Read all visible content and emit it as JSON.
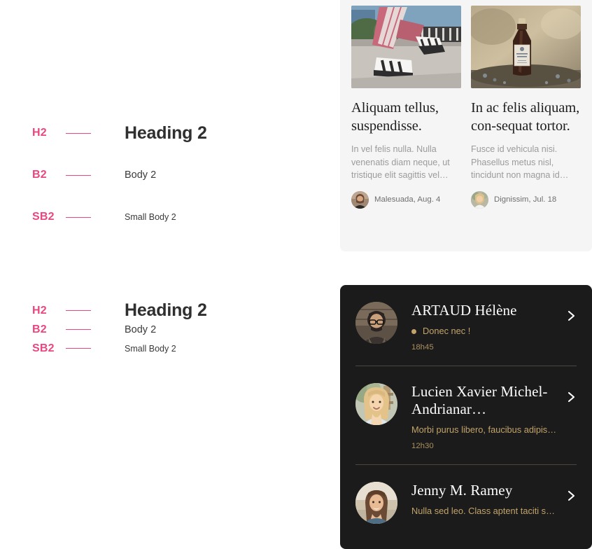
{
  "typography": {
    "groups": [
      {
        "name": "type-scale-loose",
        "rows": [
          {
            "tag": "H2",
            "sample": "Heading 2",
            "style": "s-h2"
          },
          {
            "tag": "B2",
            "sample": "Body 2",
            "style": "s-b2"
          },
          {
            "tag": "SB2",
            "sample": "Small Body 2",
            "style": "s-sb2"
          }
        ]
      },
      {
        "name": "type-scale-tight",
        "rows": [
          {
            "tag": "H2",
            "sample": "Heading 2",
            "style": "s-h2"
          },
          {
            "tag": "B2",
            "sample": "Body 2",
            "style": "s-b2"
          },
          {
            "tag": "SB2",
            "sample": "Small Body 2",
            "style": "s-sb2"
          }
        ]
      }
    ],
    "accent_color": "#ea4680",
    "sample_color": "#333333"
  },
  "articles_card": {
    "background": "#f5f5f5",
    "articles": [
      {
        "image_alt": "sneakers-photo",
        "title": "Aliquam tellus, suspendisse.",
        "excerpt": "In vel felis nulla. Nulla venenatis diam neque, ut tristique elit sagittis vel…",
        "author": "Malesuada,",
        "date": "Aug. 4",
        "byline": "Malesuada,  Aug. 4",
        "avatar_alt": "author-avatar-male"
      },
      {
        "image_alt": "bottle-photo",
        "title": "In ac felis aliquam, con-sequat tortor.",
        "excerpt": "Fusce id vehicula nisi. Phasellus metus nisl, tincidunt non magna id…",
        "author": "Dignissim,",
        "date": "Jul. 18",
        "byline": "Dignissim,  Jul. 18",
        "avatar_alt": "author-avatar-female"
      }
    ]
  },
  "messages_panel": {
    "background": "#1b1b1b",
    "accent_color": "#c2a46b",
    "items": [
      {
        "name": "ARTAUD Hélène",
        "preview": "Donec nec !",
        "time": "18h45",
        "unread": true,
        "avatar_alt": "contact-avatar-bearded-man"
      },
      {
        "name": "Lucien Xavier Michel-Andrianar…",
        "preview": "Morbi purus libero, faucibus adipiscing…",
        "time": "12h30",
        "unread": false,
        "avatar_alt": "contact-avatar-blonde-woman"
      },
      {
        "name": "Jenny M. Ramey",
        "preview": "Nulla sed leo. Class aptent taciti sociosq…",
        "time": "",
        "unread": false,
        "avatar_alt": "contact-avatar-woman-beach"
      }
    ]
  }
}
